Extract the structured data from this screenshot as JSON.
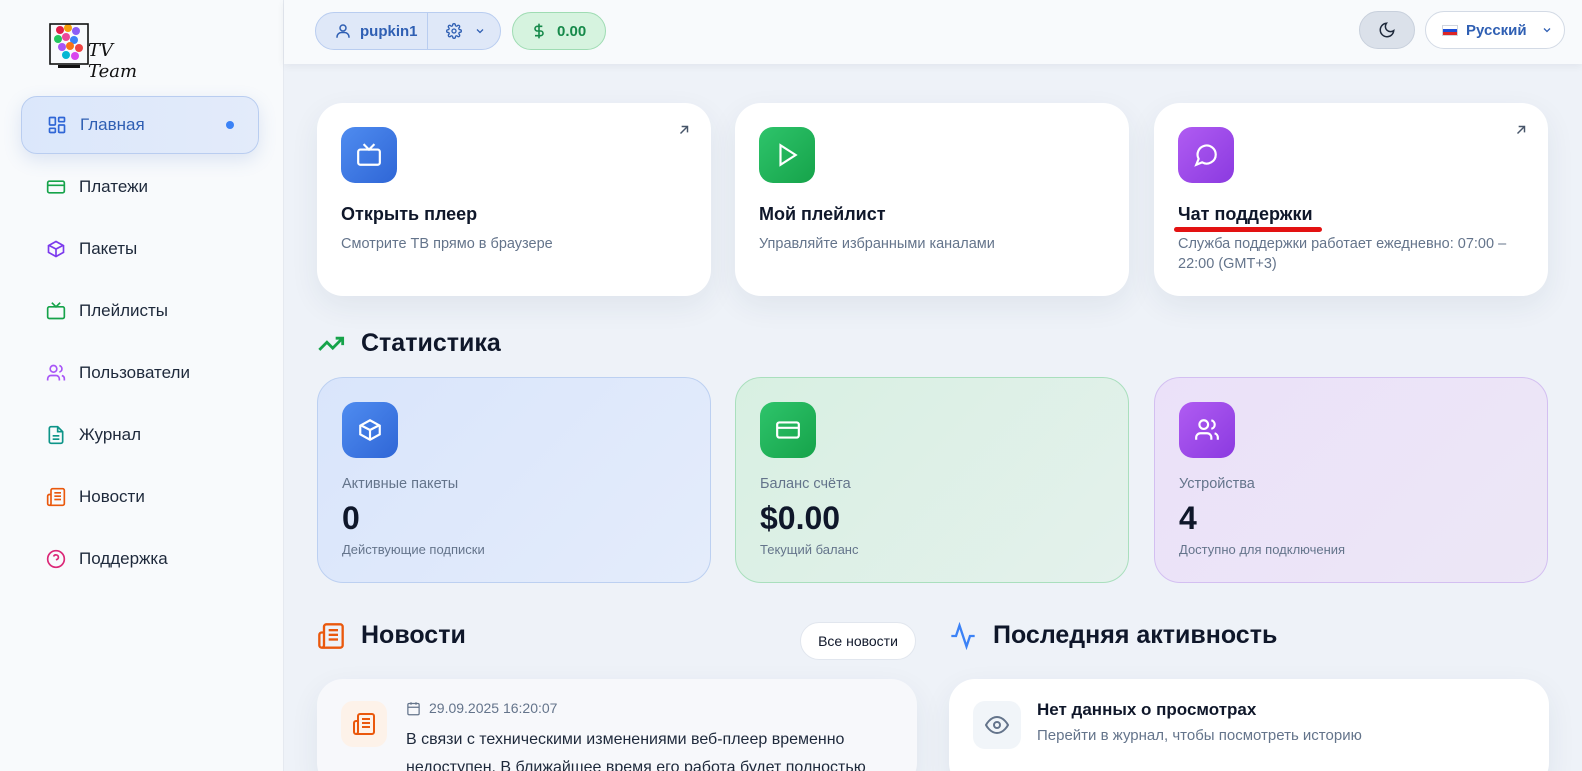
{
  "brand": {
    "logo_text": "TV Team"
  },
  "sidebar": {
    "items": [
      {
        "label": "Главная",
        "icon": "dashboard-icon",
        "active": true
      },
      {
        "label": "Платежи",
        "icon": "credit-card-icon"
      },
      {
        "label": "Пакеты",
        "icon": "package-icon"
      },
      {
        "label": "Плейлисты",
        "icon": "tv-icon"
      },
      {
        "label": "Пользователи",
        "icon": "users-icon"
      },
      {
        "label": "Журнал",
        "icon": "file-text-icon"
      },
      {
        "label": "Новости",
        "icon": "newspaper-icon"
      },
      {
        "label": "Поддержка",
        "icon": "help-circle-icon"
      }
    ]
  },
  "header": {
    "username": "pupkin1",
    "balance": "0.00",
    "language": "Русский"
  },
  "quick": [
    {
      "title": "Открыть плеер",
      "desc": "Смотрите ТВ прямо в браузере"
    },
    {
      "title": "Мой плейлист",
      "desc": "Управляйте избранными каналами"
    },
    {
      "title": "Чат поддержки",
      "desc": "Служба поддержки работает ежедневно: 07:00 – 22:00 (GMT+3)"
    }
  ],
  "stats_title": "Статистика",
  "stats": [
    {
      "label": "Активные пакеты",
      "value": "0",
      "sub": "Действующие подписки"
    },
    {
      "label": "Баланс счёта",
      "value": "$0.00",
      "sub": "Текущий баланс"
    },
    {
      "label": "Устройства",
      "value": "4",
      "sub": "Доступно для подключения"
    }
  ],
  "news": {
    "title": "Новости",
    "all_label": "Все новости",
    "items": [
      {
        "date": "29.09.2025 16:20:07",
        "text": "В связи с техническими изменениями веб-плеер временно недоступен. В ближайшее время его работа будет полностью"
      }
    ]
  },
  "activity": {
    "title": "Последняя активность",
    "empty_title": "Нет данных о просмотрах",
    "empty_desc": "Перейти в журнал, чтобы посмотреть историю"
  },
  "colors": {
    "accent": "#2f5fb3",
    "green": "#16a34a",
    "purple": "#8b3ae0",
    "annotation": "#e31212"
  }
}
